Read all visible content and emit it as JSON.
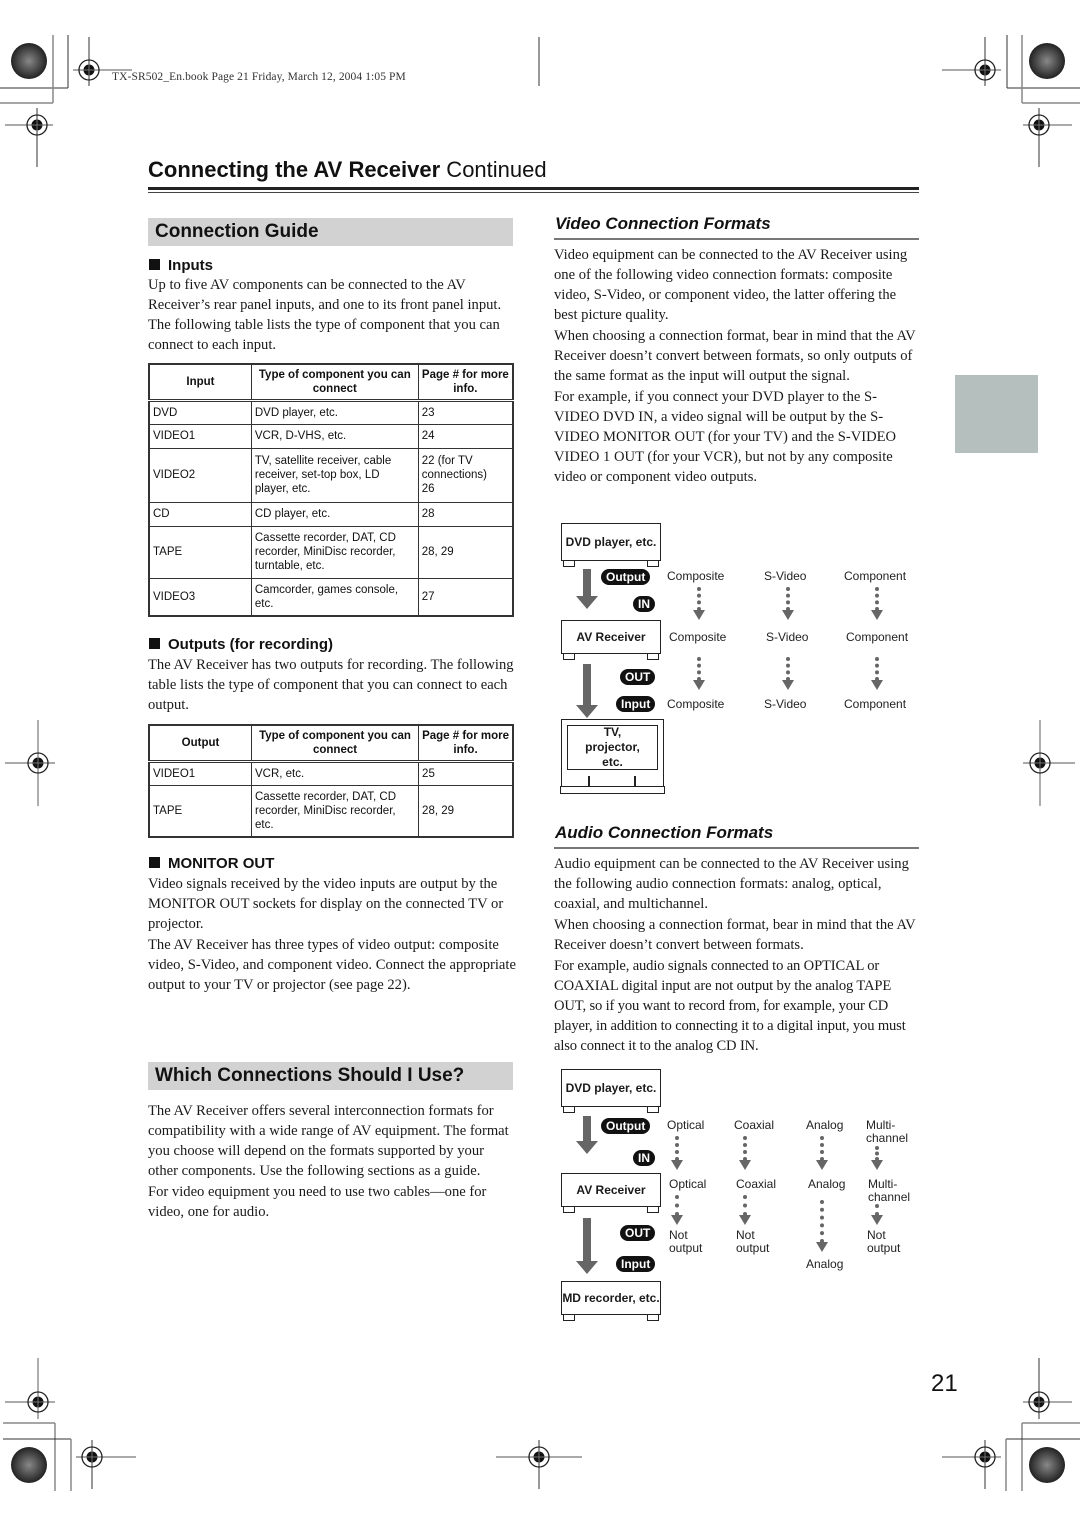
{
  "header": {
    "book_line": "TX-SR502_En.book  Page 21  Friday, March 12, 2004  1:05 PM",
    "title_bold": "Connecting the AV Receiver",
    "title_light": " Continued"
  },
  "connection_guide": {
    "heading": "Connection Guide",
    "inputs": {
      "heading": "Inputs",
      "text": "Up to five AV components can be connected to the AV Receiver’s rear panel inputs, and one to its front panel input. The following table lists the type of component that you can connect to each input.",
      "table": {
        "headers": [
          "Input",
          "Type of component you can connect",
          "Page # for more info."
        ],
        "rows": [
          [
            "DVD",
            "DVD player, etc.",
            "23"
          ],
          [
            "VIDEO1",
            "VCR, D-VHS, etc.",
            "24"
          ],
          [
            "VIDEO2",
            "TV, satellite receiver, cable receiver, set-top box, LD player, etc.",
            "22 (for TV connections)\n26"
          ],
          [
            "CD",
            "CD player, etc.",
            "28"
          ],
          [
            "TAPE",
            "Cassette recorder, DAT, CD recorder, MiniDisc recorder, turntable, etc.",
            "28, 29"
          ],
          [
            "VIDEO3",
            "Camcorder, games console, etc.",
            "27"
          ]
        ]
      }
    },
    "outputs": {
      "heading": "Outputs (for recording)",
      "text": "The AV Receiver has two outputs for recording. The following table lists the type of component that you can connect to each output.",
      "table": {
        "headers": [
          "Output",
          "Type of component you can connect",
          "Page # for more info."
        ],
        "rows": [
          [
            "VIDEO1",
            "VCR, etc.",
            "25"
          ],
          [
            "TAPE",
            "Cassette recorder, DAT, CD recorder, MiniDisc recorder, etc.",
            "28, 29"
          ]
        ]
      }
    },
    "monitor_out": {
      "heading": "MONITOR OUT",
      "para1": "Video signals received by the video inputs are output by the MONITOR OUT sockets for display on the connected TV or projector.",
      "para2": "The AV Receiver has three types of video output: composite video, S-Video, and component video. Connect the appropriate output to your TV or projector (see page 22)."
    }
  },
  "which_connections": {
    "heading": "Which Connections Should I Use?",
    "para1": "The AV Receiver offers several interconnection formats for compatibility with a wide range of AV equipment. The format you choose will depend on the formats supported by your other components. Use the following sections as a guide.",
    "para2": "For video equipment you need to use two cables—one for video, one for audio."
  },
  "video_formats": {
    "heading": "Video Connection Formats",
    "para1": "Video equipment can be connected to the AV Receiver using one of the following video connection formats: composite video, S-Video, or component video, the latter offering the best picture quality.",
    "para2": "When choosing a connection format, bear in mind that the AV Receiver doesn’t convert between formats, so only outputs of the same format as the input will output the signal.",
    "para3": "For example, if you connect your DVD player to the S-VIDEO DVD IN, a video signal will be output by the S-VIDEO MONITOR OUT (for your TV) and the S-VIDEO VIDEO 1 OUT (for your VCR), but not by any composite video or component video outputs.",
    "diagram": {
      "source": "DVD player, etc.",
      "receiver": "AV Receiver",
      "destination": "TV, projector, etc.",
      "pills": {
        "output": "Output",
        "in": "IN",
        "out": "OUT",
        "input": "Input"
      },
      "row_source": [
        "Composite",
        "S-Video",
        "Component"
      ],
      "row_receiver": [
        "Composite",
        "S-Video",
        "Component"
      ],
      "row_destination": [
        "Composite",
        "S-Video",
        "Component"
      ]
    }
  },
  "audio_formats": {
    "heading": "Audio Connection Formats",
    "para1": "Audio equipment can be connected to the AV Receiver using the following audio connection formats: analog, optical, coaxial, and multichannel.",
    "para2": "When choosing a connection format, bear in mind that the AV Receiver doesn’t convert between formats.",
    "para3": "For example, audio signals connected to an OPTICAL or COAXIAL digital input are not output by the analog TAPE OUT, so if you want to record from, for example, your CD player, in addition to connecting it to a digital input, you must also connect it to the analog CD IN.",
    "diagram": {
      "source": "DVD player, etc.",
      "receiver": "AV Receiver",
      "destination": "MD recorder, etc.",
      "pills": {
        "output": "Output",
        "in": "IN",
        "out": "OUT",
        "input": "Input"
      },
      "row_source": [
        "Optical",
        "Coaxial",
        "Analog",
        "Multi-\nchannel"
      ],
      "row_receiver": [
        "Optical",
        "Coaxial",
        "Analog",
        "Multi-\nchannel"
      ],
      "row_out": [
        "Not\noutput",
        "Not\noutput",
        "",
        "Not\noutput"
      ],
      "row_destination": [
        "",
        "",
        "Analog",
        ""
      ]
    }
  },
  "footer": {
    "page_number": "21"
  },
  "colors": {
    "section_heading_bg": "#d2d2d2",
    "side_tab": "#b4bfbe",
    "arrow_gray": "#666666"
  }
}
